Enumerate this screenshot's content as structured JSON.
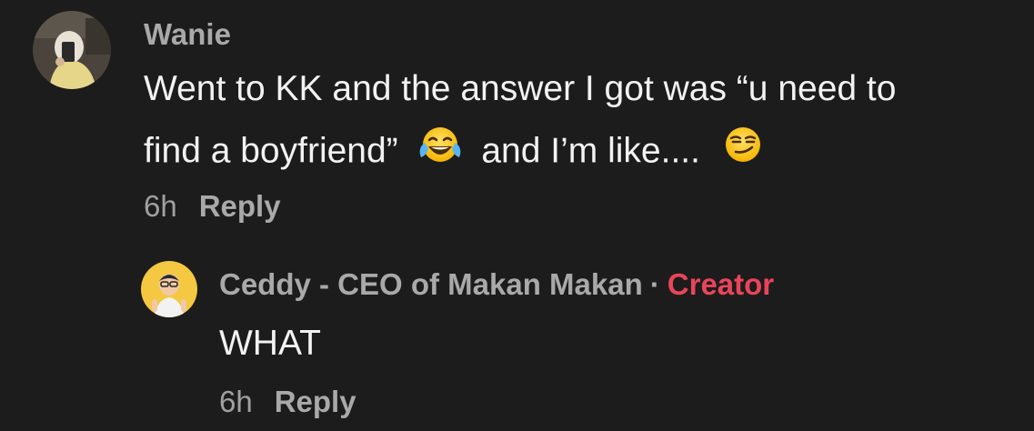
{
  "comments": [
    {
      "author": "Wanie",
      "line1": "Went to KK and the answer I got was “u need to",
      "line2_part1": "find a boyfriend”",
      "emoji1": "face-with-tears-of-joy",
      "line2_part2": "and I’m like....",
      "emoji2": "smirking-face",
      "time": "6h",
      "reply_label": "Reply"
    },
    {
      "author": "Ceddy - CEO of Makan Makan",
      "separator": "·",
      "badge": "Creator",
      "text": "WHAT",
      "time": "6h",
      "reply_label": "Reply"
    }
  ],
  "colors": {
    "background": "#1c1c1c",
    "name": "#a9a9a9",
    "creator_badge": "#e9455a"
  }
}
